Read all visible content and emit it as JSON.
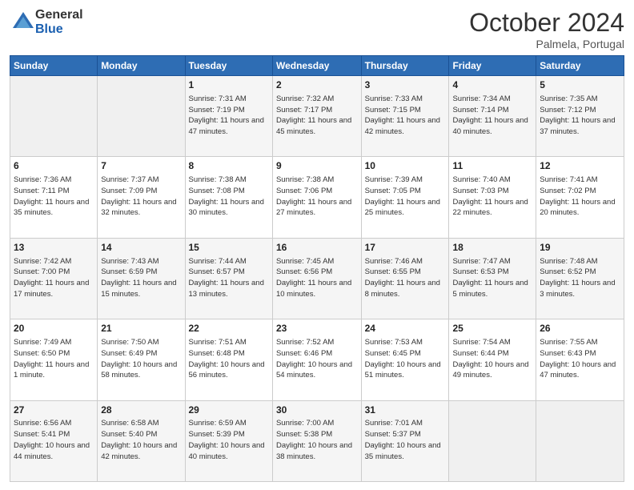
{
  "header": {
    "logo_general": "General",
    "logo_blue": "Blue",
    "month": "October 2024",
    "location": "Palmela, Portugal"
  },
  "days_of_week": [
    "Sunday",
    "Monday",
    "Tuesday",
    "Wednesday",
    "Thursday",
    "Friday",
    "Saturday"
  ],
  "weeks": [
    [
      {
        "day": "",
        "info": ""
      },
      {
        "day": "",
        "info": ""
      },
      {
        "day": "1",
        "info": "Sunrise: 7:31 AM\nSunset: 7:19 PM\nDaylight: 11 hours and 47 minutes."
      },
      {
        "day": "2",
        "info": "Sunrise: 7:32 AM\nSunset: 7:17 PM\nDaylight: 11 hours and 45 minutes."
      },
      {
        "day": "3",
        "info": "Sunrise: 7:33 AM\nSunset: 7:15 PM\nDaylight: 11 hours and 42 minutes."
      },
      {
        "day": "4",
        "info": "Sunrise: 7:34 AM\nSunset: 7:14 PM\nDaylight: 11 hours and 40 minutes."
      },
      {
        "day": "5",
        "info": "Sunrise: 7:35 AM\nSunset: 7:12 PM\nDaylight: 11 hours and 37 minutes."
      }
    ],
    [
      {
        "day": "6",
        "info": "Sunrise: 7:36 AM\nSunset: 7:11 PM\nDaylight: 11 hours and 35 minutes."
      },
      {
        "day": "7",
        "info": "Sunrise: 7:37 AM\nSunset: 7:09 PM\nDaylight: 11 hours and 32 minutes."
      },
      {
        "day": "8",
        "info": "Sunrise: 7:38 AM\nSunset: 7:08 PM\nDaylight: 11 hours and 30 minutes."
      },
      {
        "day": "9",
        "info": "Sunrise: 7:38 AM\nSunset: 7:06 PM\nDaylight: 11 hours and 27 minutes."
      },
      {
        "day": "10",
        "info": "Sunrise: 7:39 AM\nSunset: 7:05 PM\nDaylight: 11 hours and 25 minutes."
      },
      {
        "day": "11",
        "info": "Sunrise: 7:40 AM\nSunset: 7:03 PM\nDaylight: 11 hours and 22 minutes."
      },
      {
        "day": "12",
        "info": "Sunrise: 7:41 AM\nSunset: 7:02 PM\nDaylight: 11 hours and 20 minutes."
      }
    ],
    [
      {
        "day": "13",
        "info": "Sunrise: 7:42 AM\nSunset: 7:00 PM\nDaylight: 11 hours and 17 minutes."
      },
      {
        "day": "14",
        "info": "Sunrise: 7:43 AM\nSunset: 6:59 PM\nDaylight: 11 hours and 15 minutes."
      },
      {
        "day": "15",
        "info": "Sunrise: 7:44 AM\nSunset: 6:57 PM\nDaylight: 11 hours and 13 minutes."
      },
      {
        "day": "16",
        "info": "Sunrise: 7:45 AM\nSunset: 6:56 PM\nDaylight: 11 hours and 10 minutes."
      },
      {
        "day": "17",
        "info": "Sunrise: 7:46 AM\nSunset: 6:55 PM\nDaylight: 11 hours and 8 minutes."
      },
      {
        "day": "18",
        "info": "Sunrise: 7:47 AM\nSunset: 6:53 PM\nDaylight: 11 hours and 5 minutes."
      },
      {
        "day": "19",
        "info": "Sunrise: 7:48 AM\nSunset: 6:52 PM\nDaylight: 11 hours and 3 minutes."
      }
    ],
    [
      {
        "day": "20",
        "info": "Sunrise: 7:49 AM\nSunset: 6:50 PM\nDaylight: 11 hours and 1 minute."
      },
      {
        "day": "21",
        "info": "Sunrise: 7:50 AM\nSunset: 6:49 PM\nDaylight: 10 hours and 58 minutes."
      },
      {
        "day": "22",
        "info": "Sunrise: 7:51 AM\nSunset: 6:48 PM\nDaylight: 10 hours and 56 minutes."
      },
      {
        "day": "23",
        "info": "Sunrise: 7:52 AM\nSunset: 6:46 PM\nDaylight: 10 hours and 54 minutes."
      },
      {
        "day": "24",
        "info": "Sunrise: 7:53 AM\nSunset: 6:45 PM\nDaylight: 10 hours and 51 minutes."
      },
      {
        "day": "25",
        "info": "Sunrise: 7:54 AM\nSunset: 6:44 PM\nDaylight: 10 hours and 49 minutes."
      },
      {
        "day": "26",
        "info": "Sunrise: 7:55 AM\nSunset: 6:43 PM\nDaylight: 10 hours and 47 minutes."
      }
    ],
    [
      {
        "day": "27",
        "info": "Sunrise: 6:56 AM\nSunset: 5:41 PM\nDaylight: 10 hours and 44 minutes."
      },
      {
        "day": "28",
        "info": "Sunrise: 6:58 AM\nSunset: 5:40 PM\nDaylight: 10 hours and 42 minutes."
      },
      {
        "day": "29",
        "info": "Sunrise: 6:59 AM\nSunset: 5:39 PM\nDaylight: 10 hours and 40 minutes."
      },
      {
        "day": "30",
        "info": "Sunrise: 7:00 AM\nSunset: 5:38 PM\nDaylight: 10 hours and 38 minutes."
      },
      {
        "day": "31",
        "info": "Sunrise: 7:01 AM\nSunset: 5:37 PM\nDaylight: 10 hours and 35 minutes."
      },
      {
        "day": "",
        "info": ""
      },
      {
        "day": "",
        "info": ""
      }
    ]
  ]
}
